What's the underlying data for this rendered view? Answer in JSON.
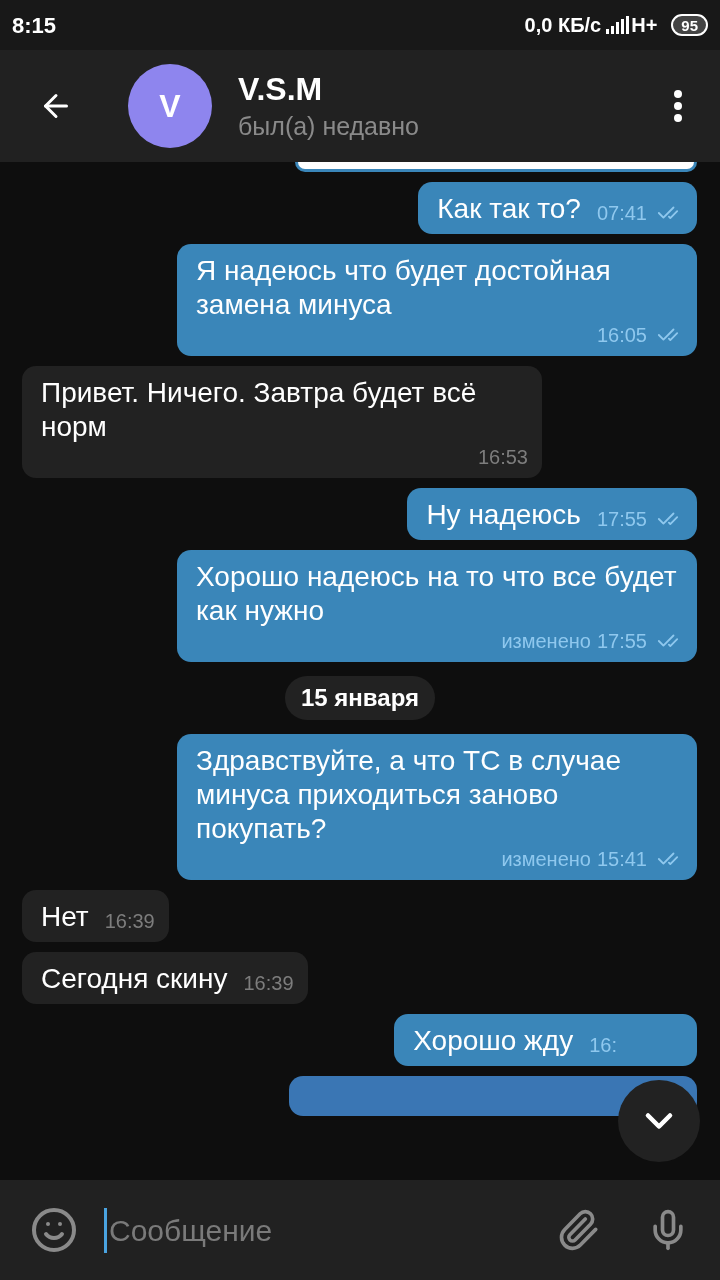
{
  "status_bar": {
    "time": "8:15",
    "speed": "0,0 КБ/с",
    "network": "H+",
    "battery": "95"
  },
  "header": {
    "avatar_letter": "V",
    "name": "V.S.M",
    "status": "был(а) недавно"
  },
  "messages": [
    {
      "kind": "message",
      "outgoing": true,
      "text": "Как так то?",
      "time": "07:41",
      "read": true
    },
    {
      "kind": "message",
      "outgoing": true,
      "text": "Я надеюсь что будет достойная замена минуса",
      "time": "16:05",
      "read": true
    },
    {
      "kind": "message",
      "outgoing": false,
      "text": "Привет. Ничего. Завтра будет всё норм",
      "time": "16:53"
    },
    {
      "kind": "message",
      "outgoing": true,
      "text": "Ну надеюсь",
      "time": "17:55",
      "read": true
    },
    {
      "kind": "message",
      "outgoing": true,
      "text": "Хорошо надеюсь на то что все будет как нужно",
      "time": "17:55",
      "edited": "изменено",
      "read": true
    },
    {
      "kind": "date",
      "text": "15 января"
    },
    {
      "kind": "message",
      "outgoing": true,
      "text": "Здравствуйте, а что ТС в случае минуса приходиться заново покупать?",
      "time": "15:41",
      "edited": "изменено",
      "read": true
    },
    {
      "kind": "message",
      "outgoing": false,
      "text": "Нет",
      "time": "16:39"
    },
    {
      "kind": "message",
      "outgoing": false,
      "text": "Сегодня скину",
      "time": "16:39"
    },
    {
      "kind": "message",
      "outgoing": true,
      "text": "Хорошо жду",
      "time": "16:"
    }
  ],
  "composer": {
    "placeholder": "Сообщение"
  }
}
